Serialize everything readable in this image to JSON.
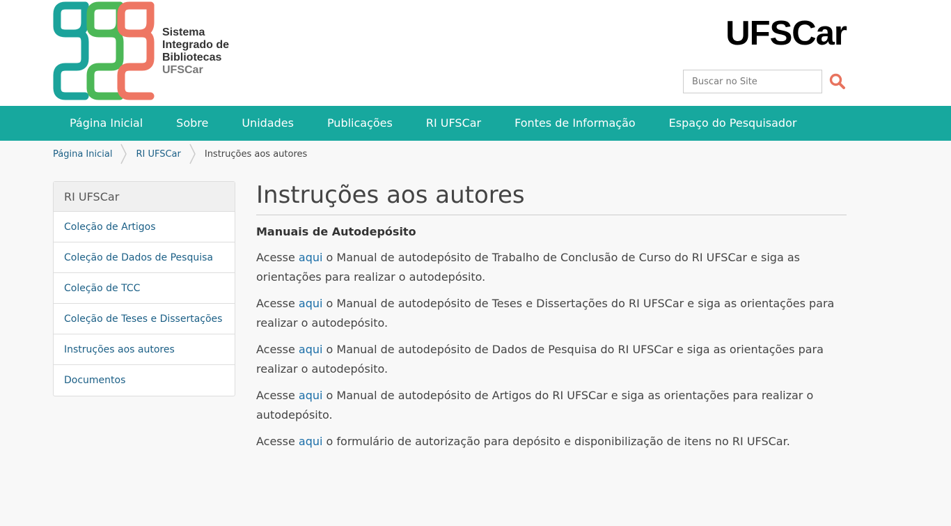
{
  "header": {
    "logo_lines": [
      "Sistema",
      "Integrado de",
      "Bibliotecas"
    ],
    "logo_sub": "UFSCar",
    "brand": "UFSCar",
    "search_placeholder": "Buscar no Site"
  },
  "nav": [
    "Página Inicial",
    "Sobre",
    "Unidades",
    "Publicações",
    "RI UFSCar",
    "Fontes de Informação",
    "Espaço do Pesquisador"
  ],
  "breadcrumb": {
    "items": [
      "Página Inicial",
      "RI UFSCar"
    ],
    "current": "Instruções aos autores"
  },
  "sidebar": {
    "title": "RI UFSCar",
    "items": [
      "Coleção de Artigos",
      "Coleção de Dados de Pesquisa",
      "Coleção de TCC",
      "Coleção de Teses e Dissertações",
      "Instruções aos autores",
      "Documentos"
    ]
  },
  "main": {
    "title": "Instruções aos autores",
    "subtitle": "Manuais de Autodepósito",
    "paragraphs": [
      {
        "pre": "Acesse ",
        "link": "aqui",
        "post": " o Manual de autodepósito de Trabalho de Conclusão de Curso do RI UFSCar e siga as orientações para realizar o autodepósito."
      },
      {
        "pre": "Acesse ",
        "link": "aqui",
        "post": " o Manual de autodepósito de Teses e Dissertações do RI UFSCar e siga as orientações para realizar o autodepósito."
      },
      {
        "pre": "Acesse ",
        "link": "aqui",
        "post": " o Manual de autodepósito de Dados de Pesquisa do RI UFSCar e siga as orientações para realizar o autodepósito."
      },
      {
        "pre": "Acesse ",
        "link": "aqui",
        "post": " o Manual de autodepósito de Artigos do RI UFSCar e siga as orientações para realizar o autodepósito."
      },
      {
        "pre": "Acesse ",
        "link": "aqui",
        "post": " o formulário de autorização para depósito e disponibilização de itens no RI UFSCar."
      }
    ]
  },
  "colors": {
    "nav_bg": "#17a89e",
    "link": "#1b5f86",
    "search_icon": "#e8735e",
    "logo_teal": "#1ba39b",
    "logo_green": "#4cb857",
    "logo_coral": "#ee7663"
  },
  "icons": [
    "ufscar-sibi-logo",
    "search-icon",
    "breadcrumb-chevron"
  ]
}
